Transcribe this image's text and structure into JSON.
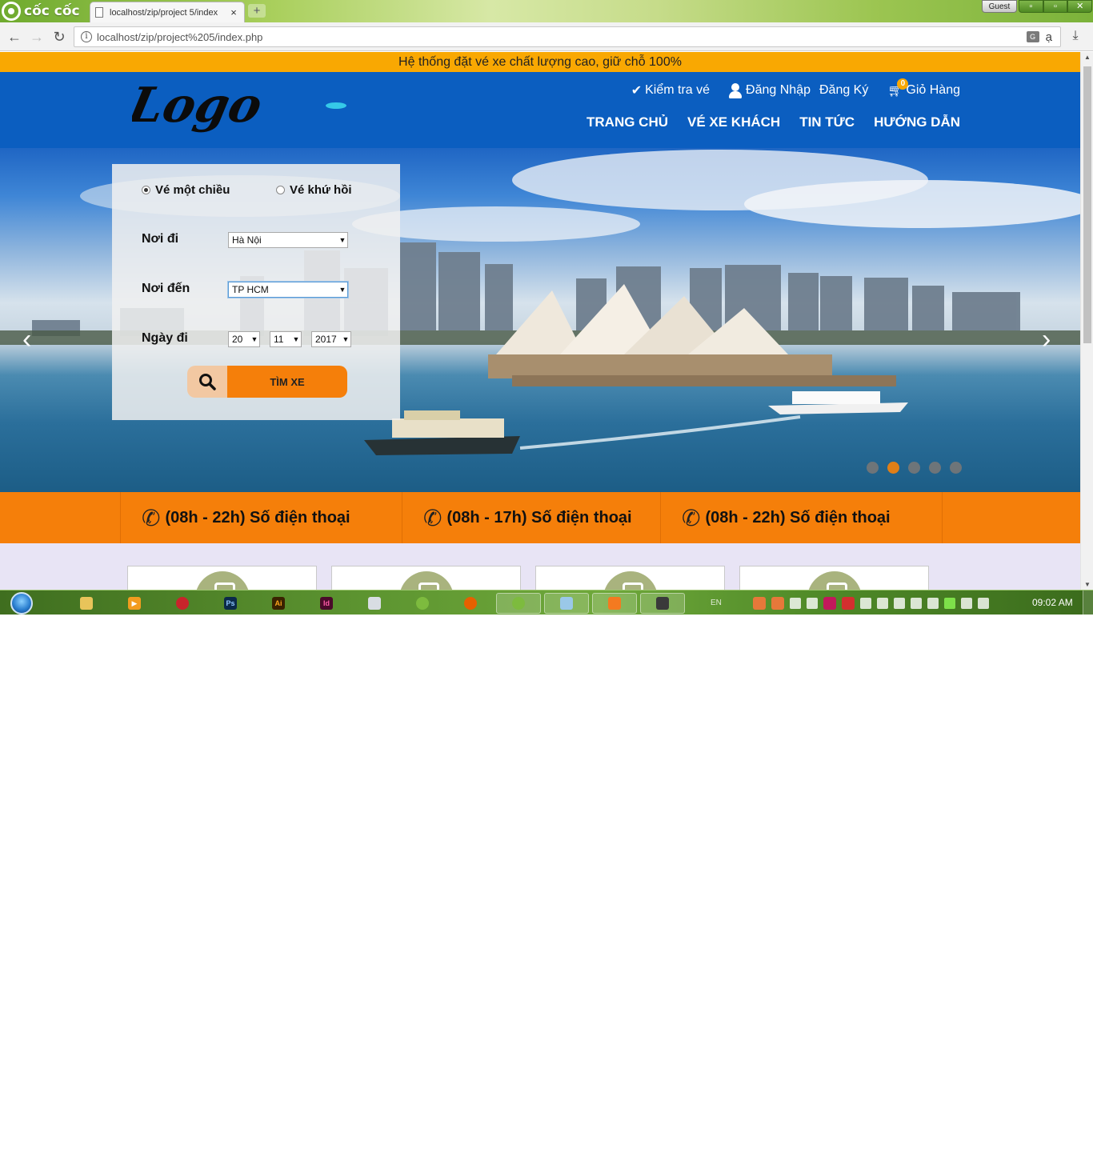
{
  "browser": {
    "brand": "cốc cốc",
    "tab_title": "localhost/zip/project 5/index",
    "tab_close": "×",
    "new_tab": "+",
    "profile": "Guest",
    "window_controls": [
      "▫",
      "▫",
      "✕"
    ],
    "url": "localhost/zip/project%205/index.php",
    "translate_icon": "G",
    "translate_glyph": "ạ"
  },
  "page": {
    "top_notice": "Hệ thống đặt vé xe chất lượng cao, giữ chỗ 100%",
    "logo_text": "Logo",
    "top_links": {
      "check_ticket": "Kiểm tra vé",
      "login": "Đăng Nhập",
      "register": "Đăng Ký",
      "cart": "Giỏ Hàng",
      "cart_count": "0"
    },
    "nav": [
      "TRANG CHỦ",
      "VÉ XE KHÁCH",
      "TIN TỨC",
      "HƯỚNG DẪN"
    ],
    "slider": {
      "prev": "‹",
      "next": "›",
      "dot_count": 5,
      "active_dot": 1
    },
    "booking": {
      "trip_type_options": [
        "Vé một chiều",
        "Vé khứ hồi"
      ],
      "trip_type_selected": "Vé một chiều",
      "from_label": "Nơi đi",
      "from_value": "Hà Nội",
      "to_label": "Nơi đến",
      "to_value": "TP HCM",
      "date_label": "Ngày đi",
      "day": "20",
      "month": "11",
      "year": "2017",
      "search_button": "TÌM XE"
    },
    "phones": [
      "(08h - 22h) Số điện thoại",
      "(08h - 17h) Số điện thoại",
      "(08h - 22h) Số điện thoại"
    ],
    "feature_card_count": 4
  },
  "taskbar": {
    "language": "EN",
    "clock": "09:02 AM"
  },
  "colors": {
    "notice": "#f9a802",
    "header": "#0b5ec0",
    "accent": "#f57f0a",
    "features_bg": "#e8e4f5",
    "card_circle": "#a9b37e"
  },
  "icons": [
    "document-icon",
    "info-icon",
    "translate-icon",
    "download-icon",
    "checkmark-icon",
    "user-icon",
    "cart-icon",
    "search-icon",
    "phone-icon",
    "windows-start-icon",
    "folder-icon",
    "media-player-icon",
    "opera-icon",
    "photoshop-icon",
    "illustrator-icon",
    "indesign-icon",
    "paint-icon",
    "coccoc-icon",
    "firefox-icon",
    "xampp-icon",
    "network-icon",
    "volume-icon",
    "flag-icon"
  ]
}
